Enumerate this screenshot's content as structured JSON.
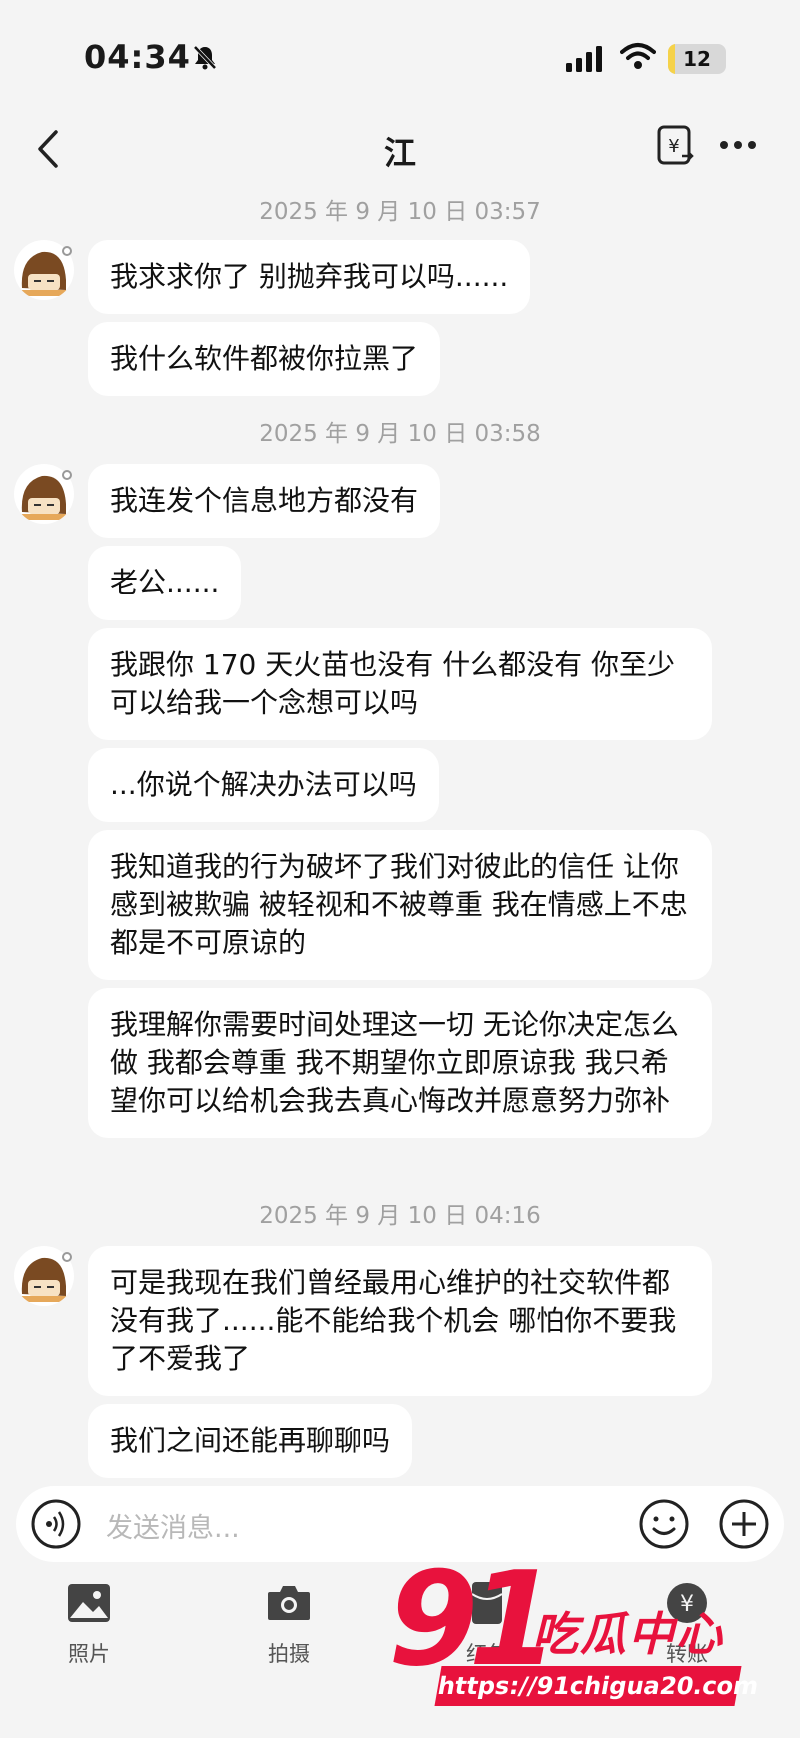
{
  "status": {
    "time": "04:34",
    "battery": "12",
    "battery_level": 0.12
  },
  "header": {
    "title": "江"
  },
  "conversation": [
    {
      "timestamp": "2025 年 9 月 10 日 03:57",
      "messages": [
        "我求求你了 别抛弃我可以吗......",
        "我什么软件都被你拉黑了"
      ]
    },
    {
      "timestamp": "2025 年 9 月 10 日 03:58",
      "messages": [
        "我连发个信息地方都没有",
        "老公......",
        "我跟你 170 天火苗也没有 什么都没有 你至少可以给我一个念想可以吗",
        "...你说个解决办法可以吗",
        "我知道我的行为破坏了我们对彼此的信任 让你感到被欺骗 被轻视和不被尊重 我在情感上不忠都是不可原谅的",
        "我理解你需要时间处理这一切 无论你决定怎么做 我都会尊重 我不期望你立即原谅我 我只希望你可以给机会我去真心悔改并愿意努力弥补"
      ]
    },
    {
      "timestamp": "2025 年 9 月 10 日 04:16",
      "messages": [
        "可是我现在我们曾经最用心维护的社交软件都没有我了......能不能给我个机会 哪怕你不要我了不爱我了",
        "我们之间还能再聊聊吗"
      ]
    }
  ],
  "input": {
    "placeholder": "发送消息..."
  },
  "toolbar": {
    "photo_label": "照片",
    "camera_label": "拍摄",
    "redpacket_label": "红包",
    "transfer_label": "转账"
  },
  "watermark": {
    "logo": "91",
    "name": "吃瓜中心",
    "url": "https://91chigua20.com"
  },
  "colors": {
    "background": "#f4f4f4",
    "bubble": "#ffffff",
    "timestamp": "#a0a0a0",
    "watermark": "#e8123d"
  }
}
